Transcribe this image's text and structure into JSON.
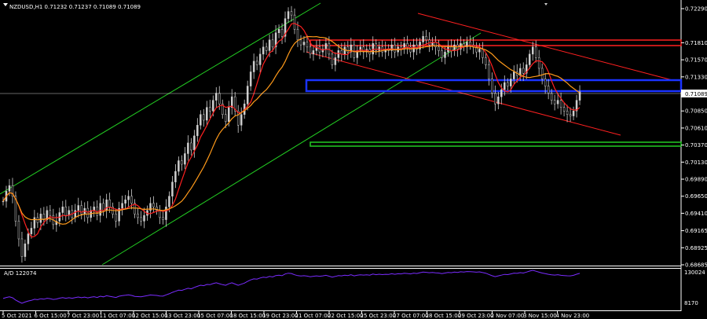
{
  "chart_data": {
    "type": "candlestick",
    "title": "NZDUSD,H1  0.71232 0.71237 0.71089 0.71089",
    "symbol": "NZDUSD,H1",
    "ohlc_readout": "0.71232 0.71237 0.71089 0.71089",
    "current_price": "0.71089",
    "price_axis": {
      "ticks": [
        "0.72290",
        "0.71810",
        "0.71570",
        "0.71330",
        "0.71089",
        "0.70850",
        "0.70610",
        "0.70370",
        "0.70130",
        "0.69890",
        "0.69650",
        "0.69410",
        "0.69165",
        "0.68925",
        "0.68685"
      ],
      "ylim": [
        0.68685,
        0.7229
      ]
    },
    "time_axis": {
      "ticks": [
        "5 Oct 2021",
        "6 Oct 15:00",
        "7 Oct 23:00",
        "11 Oct 07:00",
        "12 Oct 15:00",
        "13 Oct 23:00",
        "15 Oct 07:00",
        "18 Oct 15:00",
        "19 Oct 23:00",
        "21 Oct 07:00",
        "22 Oct 15:00",
        "25 Oct 23:00",
        "27 Oct 07:00",
        "28 Oct 15:00",
        "29 Oct 23:00",
        "2 Nov 07:00",
        "3 Nov 15:00",
        "4 Nov 23:00"
      ]
    },
    "price_series": {
      "name": "NZDUSD close",
      "x": [
        0,
        4,
        8,
        12,
        16,
        20,
        24,
        28,
        32,
        36,
        40,
        44,
        48,
        52,
        56,
        60,
        64,
        68,
        72,
        76,
        80,
        84,
        88,
        92,
        96,
        100,
        104,
        108,
        112,
        116,
        120,
        124,
        128,
        132,
        136,
        140,
        144,
        148,
        152,
        156,
        160,
        164,
        168,
        172,
        176,
        180,
        184,
        188,
        192,
        196,
        200,
        204,
        208,
        212,
        216,
        220,
        224,
        228,
        232,
        236,
        240,
        244,
        248,
        252,
        256,
        260,
        264,
        268,
        272,
        276,
        280,
        284,
        288,
        292,
        296,
        300,
        304,
        308,
        312,
        316,
        320,
        324,
        328,
        332,
        336,
        340,
        344,
        348,
        352,
        356,
        360,
        364,
        368,
        372,
        376,
        380,
        384,
        388,
        392,
        396,
        400,
        404,
        408,
        412,
        416,
        420,
        424,
        428,
        432,
        436,
        440,
        444,
        448,
        452,
        456,
        460,
        464,
        468,
        472,
        476,
        480,
        484,
        488,
        492,
        496,
        500,
        504,
        508,
        512,
        516,
        520,
        524,
        528,
        532,
        536,
        540,
        544,
        548,
        552,
        556,
        560,
        564,
        568,
        572,
        576,
        580,
        584,
        588,
        592,
        596,
        600,
        604,
        608,
        612,
        616,
        620,
        624,
        628,
        632,
        636,
        640,
        644,
        648,
        652,
        656,
        660,
        664,
        668,
        672,
        676,
        680,
        684,
        688,
        692,
        696,
        700,
        704,
        708,
        712,
        716,
        720,
        724,
        728,
        732,
        736,
        740,
        744,
        748
      ],
      "values": [
        0.6958,
        0.6972,
        0.698,
        0.6965,
        0.693,
        0.6905,
        0.688,
        0.6898,
        0.6912,
        0.692,
        0.6935,
        0.6928,
        0.694,
        0.6932,
        0.6945,
        0.6938,
        0.6925,
        0.693,
        0.6942,
        0.695,
        0.6938,
        0.6945,
        0.6935,
        0.6945,
        0.6952,
        0.694,
        0.6948,
        0.6935,
        0.6945,
        0.695,
        0.6938,
        0.6955,
        0.6945,
        0.696,
        0.695,
        0.694,
        0.693,
        0.6948,
        0.6955,
        0.696,
        0.6965,
        0.6955,
        0.694,
        0.6935,
        0.693,
        0.6938,
        0.6945,
        0.6955,
        0.695,
        0.6945,
        0.6935,
        0.6932,
        0.695,
        0.6965,
        0.6985,
        0.7,
        0.7015,
        0.701,
        0.7025,
        0.704,
        0.703,
        0.705,
        0.7065,
        0.708,
        0.7072,
        0.709,
        0.7085,
        0.71,
        0.711,
        0.7095,
        0.708,
        0.707,
        0.709,
        0.7105,
        0.7085,
        0.7065,
        0.708,
        0.7095,
        0.712,
        0.714,
        0.7155,
        0.715,
        0.7165,
        0.7175,
        0.717,
        0.7185,
        0.7175,
        0.7195,
        0.72,
        0.719,
        0.7215,
        0.7225,
        0.722,
        0.72,
        0.7185,
        0.7178,
        0.7182,
        0.7175,
        0.7165,
        0.717,
        0.7175,
        0.7168,
        0.7172,
        0.718,
        0.7165,
        0.715,
        0.716,
        0.717,
        0.7165,
        0.7175,
        0.7168,
        0.7178,
        0.716,
        0.717,
        0.7175,
        0.7168,
        0.7172,
        0.7165,
        0.718,
        0.717,
        0.7175,
        0.7168,
        0.7172,
        0.717,
        0.7178,
        0.7168,
        0.7175,
        0.7172,
        0.718,
        0.7175,
        0.7168,
        0.7178,
        0.7172,
        0.7182,
        0.719,
        0.7185,
        0.7178,
        0.7182,
        0.7175,
        0.717,
        0.716,
        0.7168,
        0.7175,
        0.717,
        0.7178,
        0.7172,
        0.718,
        0.7175,
        0.7182,
        0.7178,
        0.7175,
        0.7168,
        0.7172,
        0.716,
        0.715,
        0.713,
        0.711,
        0.7095,
        0.7105,
        0.7115,
        0.7125,
        0.712,
        0.713,
        0.714,
        0.7135,
        0.7145,
        0.7138,
        0.715,
        0.7165,
        0.7175,
        0.716,
        0.7145,
        0.713,
        0.712,
        0.711,
        0.71,
        0.7095,
        0.71,
        0.709,
        0.7085,
        0.708,
        0.7078,
        0.7085,
        0.71,
        0.7112
      ]
    },
    "indicator": {
      "label": "A/D 122074",
      "axis_ticks": [
        "130024",
        "8170"
      ]
    }
  },
  "colors": {
    "background": "#000000",
    "candles": "#cfcfcf",
    "ma_fast": "#ff2020",
    "ma_slow": "#ff9a1a",
    "channel_green": "#22cc22",
    "channel_red": "#ff2020",
    "zone_red": "#ff2020",
    "zone_blue": "#1a33ff",
    "zone_green": "#22cc22",
    "ad_line": "#7a2cff"
  }
}
